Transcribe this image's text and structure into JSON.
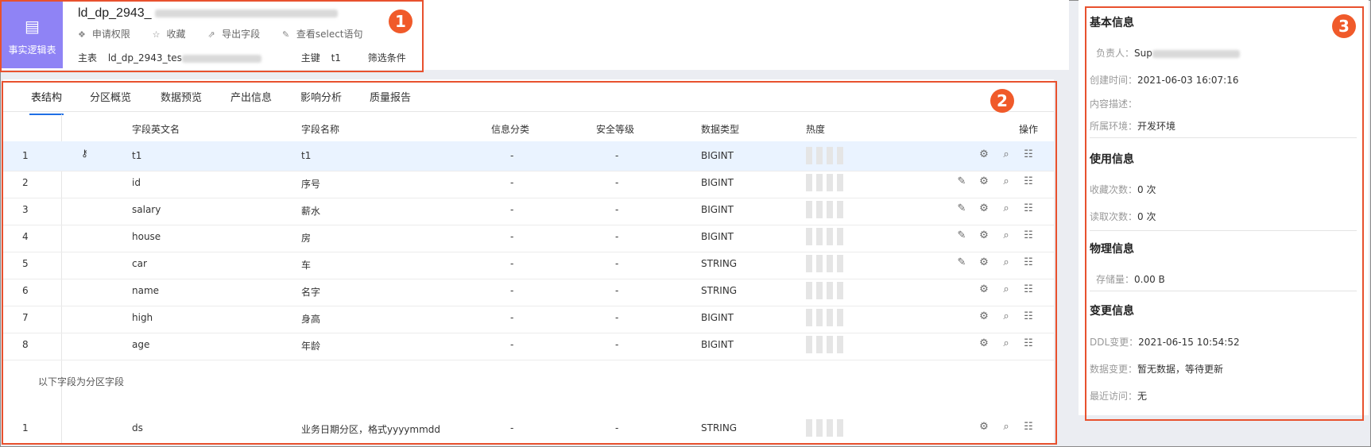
{
  "header": {
    "type_badge": "事实逻辑表",
    "table_name": "ld_dp_2943_",
    "actions": [
      {
        "label": "申请权限",
        "icon": "key-icon"
      },
      {
        "label": "收藏",
        "icon": "star-icon"
      },
      {
        "label": "导出字段",
        "icon": "export-icon"
      },
      {
        "label": "查看select语句",
        "icon": "sql-icon"
      }
    ],
    "main_table_label": "主表",
    "main_table_value": "ld_dp_2943_tes",
    "primary_key_label": "主键",
    "primary_key_value": "t1",
    "filter_label": "筛选条件"
  },
  "callouts": [
    "1",
    "2",
    "3"
  ],
  "tabs": [
    "表结构",
    "分区概览",
    "数据预览",
    "产出信息",
    "影响分析",
    "质量报告"
  ],
  "columns": [
    "字段英文名",
    "字段名称",
    "信息分类",
    "安全等级",
    "数据类型",
    "热度",
    "操作"
  ],
  "rows": [
    {
      "idx": "1",
      "en": "t1",
      "cn": "t1",
      "cls": "-",
      "sec": "-",
      "type": "BIGINT",
      "pk": true,
      "edit": false
    },
    {
      "idx": "2",
      "en": "id",
      "cn": "序号",
      "cls": "-",
      "sec": "-",
      "type": "BIGINT",
      "pk": false,
      "edit": true
    },
    {
      "idx": "3",
      "en": "salary",
      "cn": "薪水",
      "cls": "-",
      "sec": "-",
      "type": "BIGINT",
      "pk": false,
      "edit": true
    },
    {
      "idx": "4",
      "en": "house",
      "cn": "房",
      "cls": "-",
      "sec": "-",
      "type": "BIGINT",
      "pk": false,
      "edit": true
    },
    {
      "idx": "5",
      "en": "car",
      "cn": "车",
      "cls": "-",
      "sec": "-",
      "type": "STRING",
      "pk": false,
      "edit": true
    },
    {
      "idx": "6",
      "en": "name",
      "cn": "名字",
      "cls": "-",
      "sec": "-",
      "type": "STRING",
      "pk": false,
      "edit": false
    },
    {
      "idx": "7",
      "en": "high",
      "cn": "身高",
      "cls": "-",
      "sec": "-",
      "type": "BIGINT",
      "pk": false,
      "edit": false
    },
    {
      "idx": "8",
      "en": "age",
      "cn": "年龄",
      "cls": "-",
      "sec": "-",
      "type": "BIGINT",
      "pk": false,
      "edit": false
    }
  ],
  "partition_note": "以下字段为分区字段",
  "partition_rows": [
    {
      "idx": "1",
      "en": "ds",
      "cn": "业务日期分区，格式yyyymmdd",
      "cls": "-",
      "sec": "-",
      "type": "STRING"
    }
  ],
  "side": {
    "basic_title": "基本信息",
    "owner_label": "负责人：",
    "owner_value": "Sup",
    "created_label": "创建时间：",
    "created_value": "2021-06-03 16:07:16",
    "desc_label": "内容描述：",
    "env_label": "所属环境：",
    "env_value": "开发环境",
    "usage_title": "使用信息",
    "fav_label": "收藏次数：",
    "fav_value": "0 次",
    "read_label": "读取次数：",
    "read_value": "0 次",
    "physical_title": "物理信息",
    "storage_label": "存储量：",
    "storage_value": "0.00 B",
    "change_title": "变更信息",
    "ddl_label": "DDL变更：",
    "ddl_value": "2021-06-15 10:54:52",
    "data_change_label": "数据变更：",
    "data_change_value": "暂无数据，等待更新",
    "recent_label": "最近访问：",
    "recent_value": "无"
  }
}
